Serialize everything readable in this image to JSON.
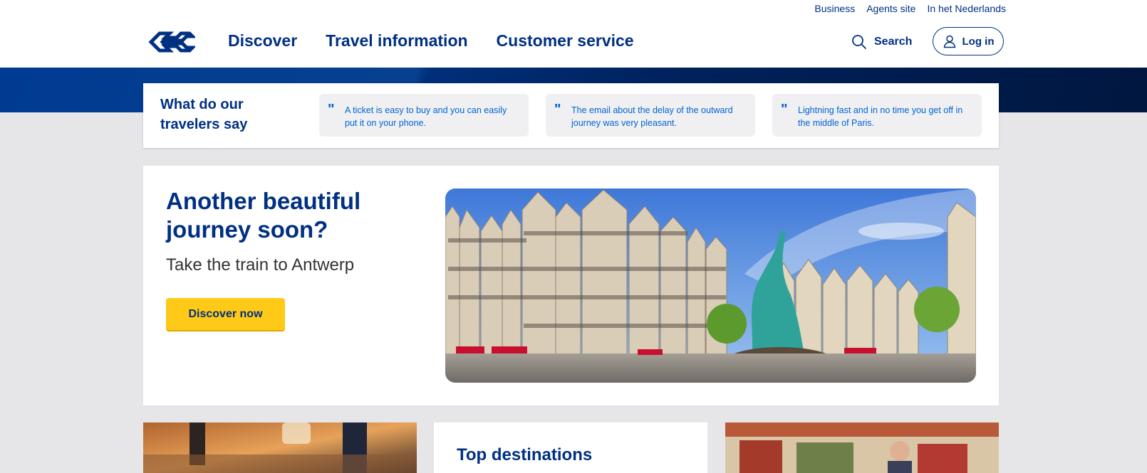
{
  "header": {
    "top_links": [
      "Business",
      "Agents site",
      "In het Nederlands"
    ],
    "nav": [
      "Discover",
      "Travel information",
      "Customer service"
    ],
    "search_label": "Search",
    "login_label": "Log in"
  },
  "reviews": {
    "title": "What do our travelers say",
    "quotes": [
      "A ticket is easy to buy and you can easily put it on your phone.",
      "The email about the delay of the outward journey was very pleasant.",
      "Lightning fast and in no time you get off in the middle of Paris."
    ]
  },
  "hero": {
    "title": "Another beautiful journey soon?",
    "subtitle": "Take the train to Antwerp",
    "cta_label": "Discover now"
  },
  "tiles": {
    "middle_title": "Top destinations"
  },
  "colors": {
    "brand_blue": "#003082",
    "link_blue": "#0063d3",
    "cta_yellow": "#ffc917",
    "page_bg": "#e6e6e9"
  },
  "icons": [
    "ns-logo",
    "search-icon",
    "user-icon",
    "quote-icon"
  ]
}
